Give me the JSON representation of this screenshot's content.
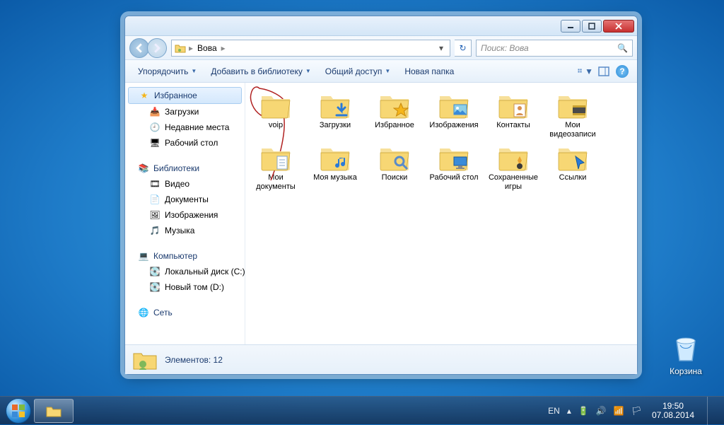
{
  "desktop": {
    "recycle_bin": "Корзина"
  },
  "window": {
    "breadcrumb": [
      "Вова"
    ],
    "search_placeholder": "Поиск: Вова",
    "toolbar": {
      "organize": "Упорядочить",
      "add_library": "Добавить в библиотеку",
      "share": "Общий доступ",
      "new_folder": "Новая папка"
    },
    "sidebar": {
      "favorites": {
        "label": "Избранное",
        "items": [
          "Загрузки",
          "Недавние места",
          "Рабочий стол"
        ]
      },
      "libraries": {
        "label": "Библиотеки",
        "items": [
          "Видео",
          "Документы",
          "Изображения",
          "Музыка"
        ]
      },
      "computer": {
        "label": "Компьютер",
        "items": [
          "Локальный диск (C:)",
          "Новый том (D:)"
        ]
      },
      "network": {
        "label": "Сеть"
      }
    },
    "items": [
      {
        "name": "voip",
        "overlay": null
      },
      {
        "name": "Загрузки",
        "overlay": "download"
      },
      {
        "name": "Избранное",
        "overlay": "star"
      },
      {
        "name": "Изображения",
        "overlay": "picture"
      },
      {
        "name": "Контакты",
        "overlay": "contact"
      },
      {
        "name": "Мои видеозаписи",
        "overlay": "video"
      },
      {
        "name": "Мои документы",
        "overlay": "doc"
      },
      {
        "name": "Моя музыка",
        "overlay": "music"
      },
      {
        "name": "Поиски",
        "overlay": "search"
      },
      {
        "name": "Рабочий стол",
        "overlay": "desktop"
      },
      {
        "name": "Сохраненные игры",
        "overlay": "game"
      },
      {
        "name": "Ссылки",
        "overlay": "link"
      }
    ],
    "status": {
      "label": "Элементов:",
      "count": "12"
    }
  },
  "taskbar": {
    "lang": "EN",
    "time": "19:50",
    "date": "07.08.2014"
  }
}
